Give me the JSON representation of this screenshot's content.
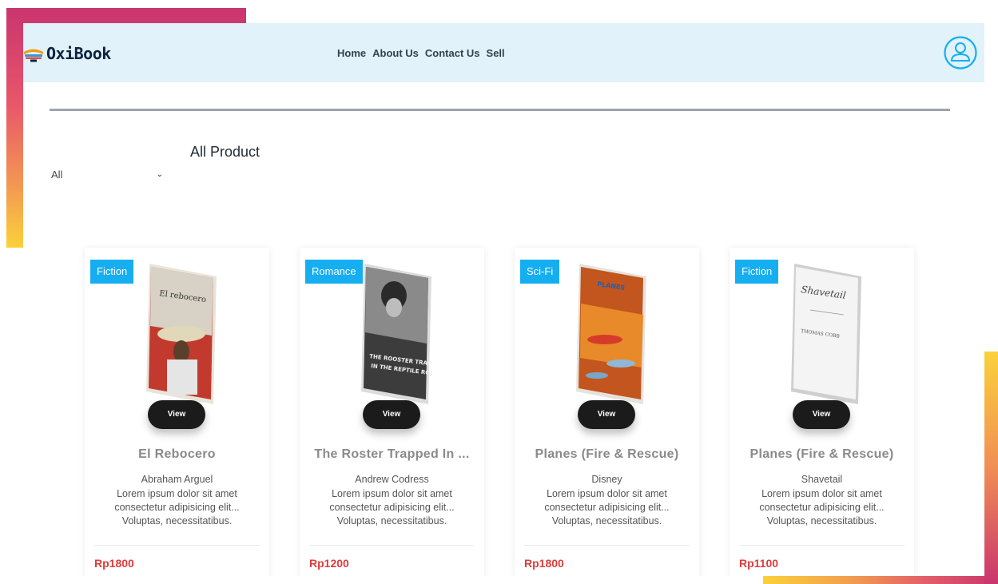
{
  "brand": {
    "name": "OxiBook"
  },
  "nav": {
    "links": [
      "Home",
      "About Us",
      "Contact Us",
      "Sell"
    ]
  },
  "section": {
    "title": "All Product"
  },
  "filter": {
    "selected": "All"
  },
  "products": [
    {
      "category": "Fiction",
      "view_label": "View",
      "title": "El Rebocero",
      "author": "Abraham Arguel",
      "description": "Lorem ipsum dolor sit amet consectetur adipisicing elit... Voluptas, necessitatibus.",
      "price": "Rp1800",
      "cover_text": "El rebocero"
    },
    {
      "category": "Romance",
      "view_label": "View",
      "title": "The Roster Trapped In ...",
      "author": "Andrew Codress",
      "description": "Lorem ipsum dolor sit amet consectetur adipisicing elit... Voluptas, necessitatibus.",
      "price": "Rp1200",
      "cover_text": "THE ROOSTER TRAPPED IN THE REPTILE ROOM"
    },
    {
      "category": "Sci-Fi",
      "view_label": "View",
      "title": "Planes (Fire & Rescue)",
      "author": "Disney",
      "description": "Lorem ipsum dolor sit amet consectetur adipisicing elit... Voluptas, necessitatibus.",
      "price": "Rp1800",
      "cover_text": "PLANES"
    },
    {
      "category": "Fiction",
      "view_label": "View",
      "title": "Planes (Fire & Rescue)",
      "author": "Shavetail",
      "description": "Lorem ipsum dolor sit amet consectetur adipisicing elit... Voluptas, necessitatibus.",
      "price": "Rp1100",
      "cover_text": "Shavetail"
    }
  ],
  "colors": {
    "navbar_bg": "#e1f2fb",
    "badge": "#15aef0",
    "price": "#e23a3a",
    "accent_gradient": [
      "#c9356e",
      "#fbd13a"
    ]
  },
  "icons": {
    "logo": "book-stack-icon",
    "user": "user-circle-icon",
    "dropdown": "chevron-down-icon"
  }
}
